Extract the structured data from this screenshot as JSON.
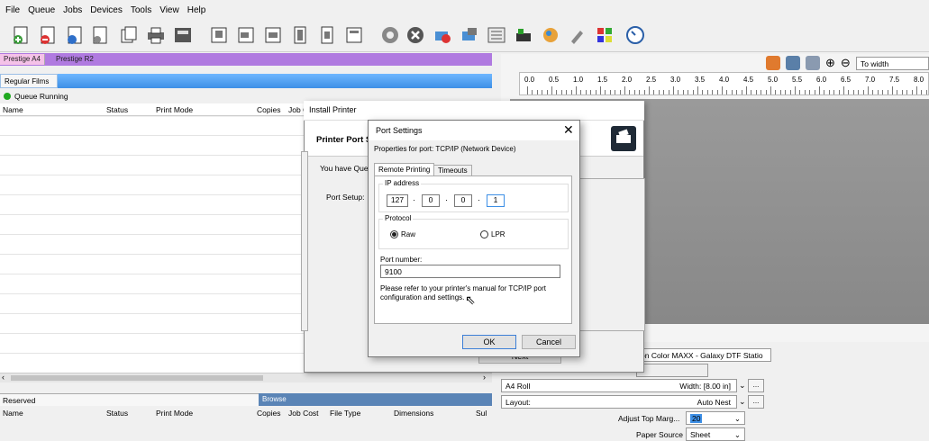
{
  "menu": [
    "File",
    "Queue",
    "Jobs",
    "Devices",
    "Tools",
    "View",
    "Help"
  ],
  "printer_tabs": [
    "Prestige A4",
    "Prestige R2"
  ],
  "films_label": "Regular Films",
  "queue_status": "Queue Running",
  "queue_columns": [
    "Name",
    "Status",
    "Print Mode",
    "Copies",
    "Job C"
  ],
  "ruler": {
    "labels": [
      "0.0",
      "0.5",
      "1.0",
      "1.5",
      "2.0",
      "2.5",
      "3.0",
      "3.5",
      "4.0",
      "4.5",
      "5.0",
      "5.5",
      "6.0",
      "6.5",
      "7.0",
      "7.5",
      "8.0"
    ],
    "zoom_value": "To width"
  },
  "lower": {
    "reserved_label": "Reserved",
    "browse_label": "Browse",
    "columns": [
      "Name",
      "Status",
      "Print Mode",
      "Copies",
      "Job Cost",
      "File Type",
      "Dimensions",
      "Sul"
    ]
  },
  "props": {
    "printer_value": "on Color MAXX - Galaxy DTF Statio",
    "roll_label": "A4 Roll",
    "width_label": "Width: [8.00 in]",
    "layout_label": "Layout:",
    "layout_value": "Auto Nest",
    "adjust_label": "Adjust Top Marg...",
    "adjust_value": "20",
    "paper_label": "Paper Source",
    "paper_value": "Sheet",
    "more": "..."
  },
  "install": {
    "title": "Install Printer",
    "heading": "Printer Port S",
    "text": "You have Queu",
    "port_setup": "Port Setup:",
    "next": "Next"
  },
  "port": {
    "title": "Port Settings",
    "subtitle": "Properties for port: TCP/IP (Network Device)",
    "tabs": [
      "Remote Printing",
      "Timeouts"
    ],
    "ip_label": "IP address",
    "ip": [
      "127",
      "0",
      "0",
      "1"
    ],
    "protocol_label": "Protocol",
    "raw": "Raw",
    "lpr": "LPR",
    "port_number_label": "Port number:",
    "port_number": "9100",
    "note": "Please refer to your printer's manual for TCP/IP port configuration and settings.",
    "ok": "OK",
    "cancel": "Cancel"
  }
}
